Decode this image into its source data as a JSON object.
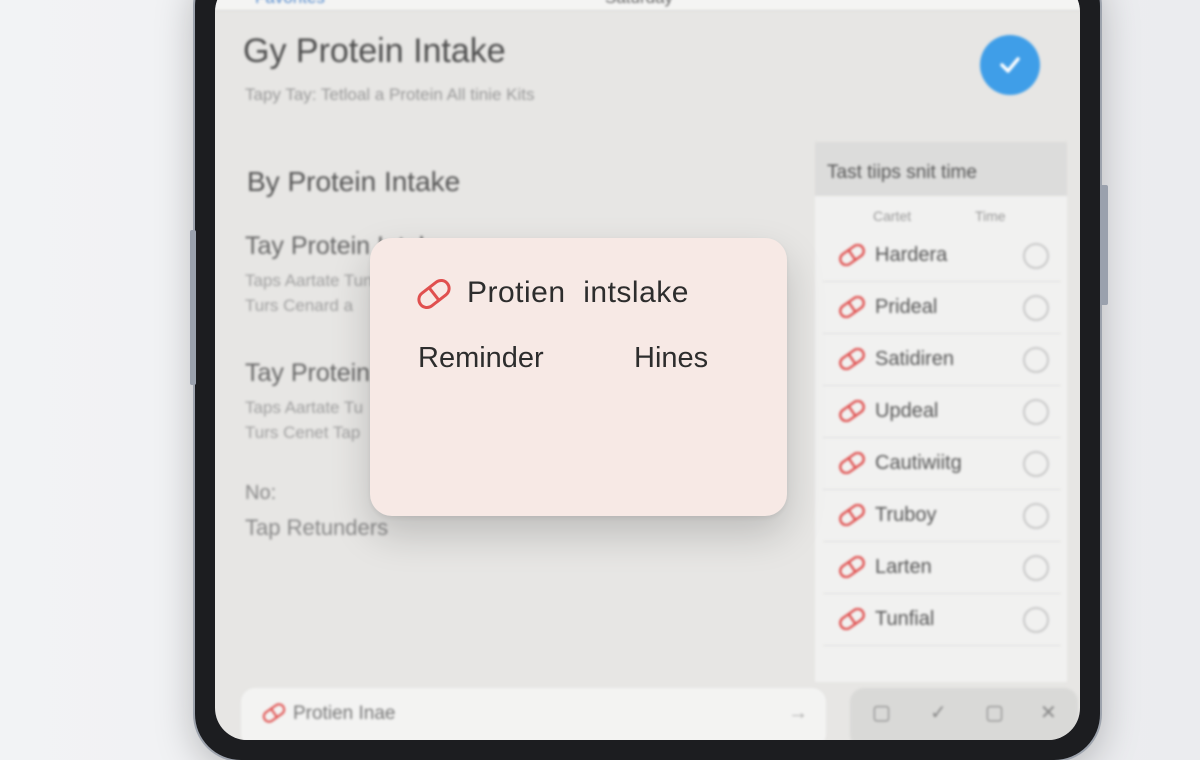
{
  "app": {
    "top_bar": {
      "back_label": "Favorites",
      "center_label": "Saturday"
    },
    "title": "Gy Protein Intake",
    "subtitle": "Tapy Tay: Tetloal a Protein All tinie Kits",
    "section_title": "By Protein Intake",
    "blocks": [
      {
        "title": "Tay Protein Intake",
        "line1": "Taps Aartate Tun",
        "line2": "Turs Cenard a"
      },
      {
        "title": "Tay Protein",
        "line1": "Taps Aartate Tu",
        "line2": "Turs Cenet Tap"
      }
    ],
    "no_label": "No:",
    "tap_reminders": "Tap Retunders"
  },
  "side_panel": {
    "header": "Tast tiips snit time",
    "col_left": "Cartet",
    "col_right": "Time",
    "items": [
      {
        "label": "Hardera"
      },
      {
        "label": "Prideal"
      },
      {
        "label": "Satidiren"
      },
      {
        "label": "Updeal"
      },
      {
        "label": "Cautiwiitg"
      },
      {
        "label": "Truboy"
      },
      {
        "label": "Larten"
      },
      {
        "label": "Tunfial"
      }
    ]
  },
  "bottom_bar": {
    "label": "Protien Inae",
    "arrow": "→",
    "icons": [
      "square",
      "check",
      "square",
      "close"
    ]
  },
  "popup": {
    "title": "Protien  intslake",
    "left_label": "Reminder",
    "right_label": "Hines"
  },
  "colors": {
    "accent": "#3f9ee8",
    "pill": "#e0504f",
    "popup_bg": "#f7e9e5"
  }
}
